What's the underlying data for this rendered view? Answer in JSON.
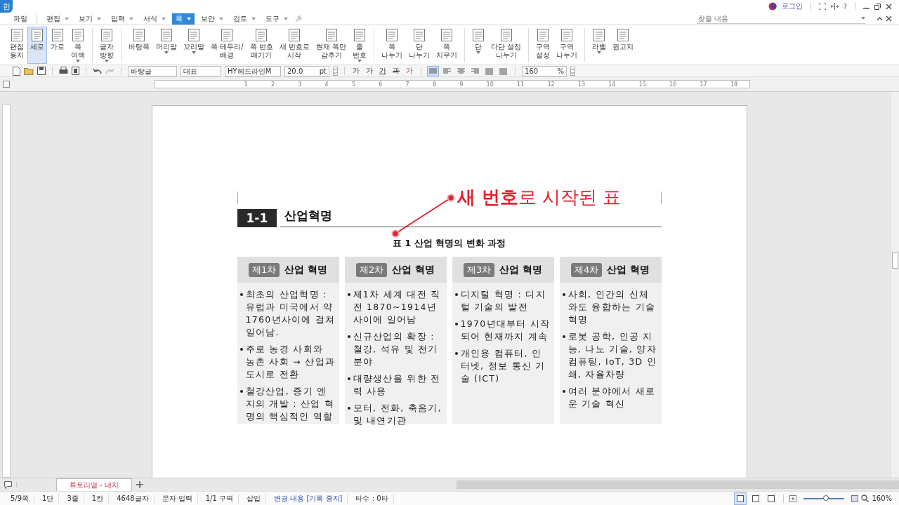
{
  "app": {
    "logo": "한",
    "login": "로그인",
    "help": "?"
  },
  "menu": [
    {
      "label": "파일",
      "caret": false,
      "selected": false
    },
    {
      "label": "편집",
      "caret": true,
      "selected": false
    },
    {
      "label": "보기",
      "caret": true,
      "selected": false
    },
    {
      "label": "입력",
      "caret": true,
      "selected": false
    },
    {
      "label": "서식",
      "caret": true,
      "selected": false
    },
    {
      "label": "쪽",
      "caret": true,
      "selected": true
    },
    {
      "label": "보안",
      "caret": true,
      "selected": false
    },
    {
      "label": "검토",
      "caret": true,
      "selected": false
    },
    {
      "label": "도구",
      "caret": true,
      "selected": false
    }
  ],
  "search": {
    "placeholder": "찾을 내용"
  },
  "ribbon": [
    [
      {
        "label": "편집\n용지",
        "caret": false,
        "selected": false
      },
      {
        "label": "세로",
        "caret": false,
        "selected": true
      },
      {
        "label": "가로",
        "caret": false,
        "selected": false
      },
      {
        "label": "쪽\n여백",
        "caret": true,
        "selected": false
      }
    ],
    [
      {
        "label": "글자\n방향",
        "caret": true,
        "selected": false
      }
    ],
    [
      {
        "label": "바탕쪽",
        "caret": false,
        "selected": false
      },
      {
        "label": "머리말",
        "caret": true,
        "selected": false
      },
      {
        "label": "꼬리말",
        "caret": true,
        "selected": false
      },
      {
        "label": "쪽 테두리/\n배경",
        "caret": false,
        "selected": false
      },
      {
        "label": "쪽 번호\n매기기",
        "caret": false,
        "selected": false
      },
      {
        "label": "새 번호로\n시작",
        "caret": false,
        "selected": false
      },
      {
        "label": "현재 쪽만\n감추기",
        "caret": false,
        "selected": false
      },
      {
        "label": "줄\n번호",
        "caret": true,
        "selected": false
      }
    ],
    [
      {
        "label": "쪽\n나누기",
        "caret": false,
        "selected": false
      },
      {
        "label": "단\n나누기",
        "caret": false,
        "selected": false
      },
      {
        "label": "쪽\n지우기",
        "caret": false,
        "selected": false
      }
    ],
    [
      {
        "label": "단",
        "caret": true,
        "selected": false
      },
      {
        "label": "다단 설정\n나누기",
        "caret": false,
        "selected": false
      }
    ],
    [
      {
        "label": "구역\n설정",
        "caret": false,
        "selected": false
      },
      {
        "label": "구역\n나누기",
        "caret": false,
        "selected": false
      }
    ],
    [
      {
        "label": "라벨",
        "caret": true,
        "selected": false
      },
      {
        "label": "원고지",
        "caret": false,
        "selected": false
      }
    ]
  ],
  "toolbar": {
    "style": "바탕글",
    "lang": "대표",
    "font": "HY헤드라인M",
    "size": "20.0",
    "size_unit": "pt",
    "char_buttons": [
      "가",
      "가",
      "가",
      "과",
      "가"
    ],
    "align": [
      {
        "selected": true
      },
      {
        "selected": false
      },
      {
        "selected": false
      },
      {
        "selected": false
      },
      {
        "selected": false
      },
      {
        "selected": false
      }
    ],
    "zoom": "160",
    "zoom_unit": "%"
  },
  "ruler": [
    "1",
    "2",
    "3",
    "4",
    "5",
    "6",
    "7",
    "8",
    "9",
    "10",
    "11",
    "12",
    "13",
    "14",
    "15",
    "16",
    "17",
    "18"
  ],
  "document": {
    "section_number": "1-1",
    "section_title": "산업혁명",
    "callout": "**새 번호**로 시작된 표",
    "caption": "표 1 산업 혁명의 변화 과정",
    "columns": [
      {
        "badge": "제1차",
        "title": "산업 혁명",
        "bullets": [
          "최초의 산업혁명 : 유럽과 미국에서 약 1760년사이에 걸쳐 일어남.",
          "주로 농경 사회와 농촌 사회 → 산업과 도시로 전환",
          "철강산업, 증기 엔지의 개발 : 산업 혁명의 핵심적인 역할"
        ]
      },
      {
        "badge": "제2차",
        "title": "산업 혁명",
        "bullets": [
          "제1차 세계 대전 직전 1870~1914년 사이에 일어남",
          "신규산업의 확장 : 철강, 석유 및 전기 분야",
          "대량생산을 위한 전력 사용",
          "모터, 전화, 축음기, 및 내연기관"
        ]
      },
      {
        "badge": "제3차",
        "title": "산업 혁명",
        "bullets": [
          "디지털 혁명 : 디지털 기술의 발전",
          "1970년대부터 시작되어 현재까지 계속",
          "개인용 컴퓨터, 인터넷, 정보 통신 기술 (ICT)"
        ]
      },
      {
        "badge": "제4차",
        "title": "산업 혁명",
        "bullets": [
          "사회, 인간의 신체와도 융합하는 기술혁명",
          "로봇 공학, 인공 지능, 나노 기술, 양자 컴퓨팅, IoT, 3D 인쇄, 자율차량",
          "여러 분야에서 새로운 기술 혁신"
        ]
      }
    ]
  },
  "tabs": [
    {
      "label": "튜토리얼 - 내지",
      "selected": true
    }
  ],
  "status": [
    {
      "text": "5/9쪽",
      "kind": "text"
    },
    {
      "text": "1단",
      "kind": "text"
    },
    {
      "text": "3줄",
      "kind": "text"
    },
    {
      "text": "1칸",
      "kind": "text"
    },
    {
      "text": "4648글자",
      "kind": "text"
    },
    {
      "text": "문자 입력",
      "kind": "text"
    },
    {
      "text": "1/1 구역",
      "kind": "text"
    },
    {
      "text": "삽입",
      "kind": "text"
    },
    {
      "text": "변경 내용 [기록 중지]",
      "kind": "link"
    },
    {
      "text": "타수 : 0타",
      "kind": "text"
    }
  ],
  "view_modes": [
    {
      "selected": true
    },
    {
      "selected": false
    },
    {
      "selected": false
    }
  ],
  "zoom": {
    "level": 0.55,
    "reading": "160%"
  }
}
